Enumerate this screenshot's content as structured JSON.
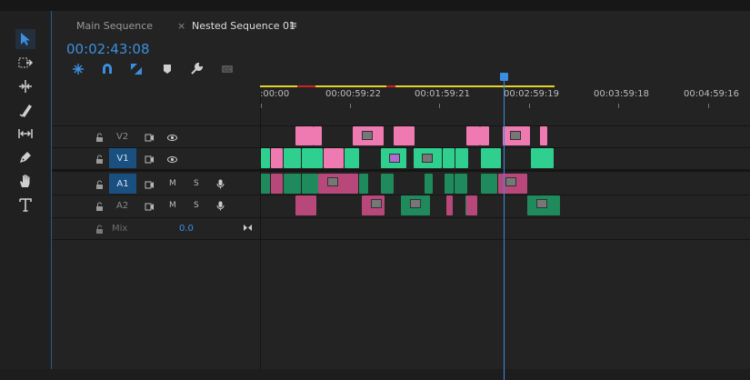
{
  "tabs": [
    {
      "label": "Main Sequence"
    },
    {
      "label": "Nested Sequence 01",
      "close": "×",
      "menu": "≡"
    }
  ],
  "timecode": "00:02:43:08",
  "ruler": [
    ":00:00",
    "00:00:59:22",
    "00:01:59:21",
    "00:02:59:19",
    "00:03:59:18",
    "00:04:59:16"
  ],
  "tracks": {
    "v2": {
      "label": "V2"
    },
    "v1": {
      "label": "V1"
    },
    "a1": {
      "label": "A1",
      "m": "M",
      "s": "S"
    },
    "a2": {
      "label": "A2",
      "m": "M",
      "s": "S"
    },
    "mix": {
      "label": "Mix",
      "value": "0.0"
    }
  },
  "toolbar_icons": [
    "snap-icon",
    "magnet-icon",
    "linked-selection-icon",
    "marker-icon",
    "wrench-icon",
    "captions-icon"
  ],
  "tools": [
    "selection-tool-icon",
    "track-select-icon",
    "ripple-edit-icon",
    "razor-icon",
    "slip-icon",
    "pen-icon",
    "hand-icon",
    "type-icon"
  ],
  "colors": {
    "accent": "#3a8de0",
    "video_clip": "#ef7ab2",
    "video_clip_alt": "#2fd08f",
    "audio_clip": "#b8477a",
    "audio_clip_alt": "#1f8a5c"
  }
}
